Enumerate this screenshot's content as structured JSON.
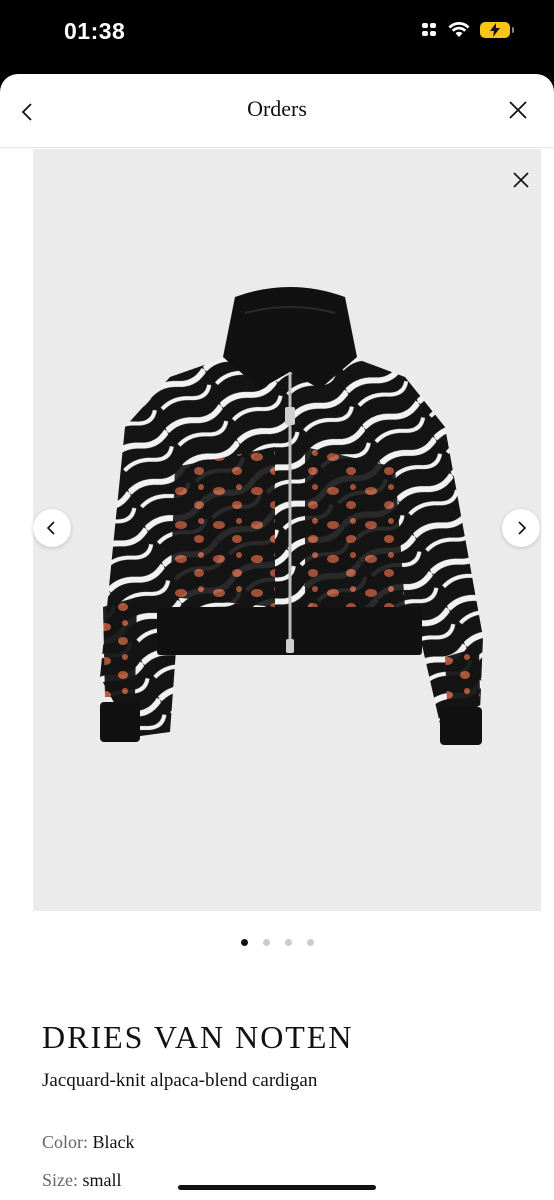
{
  "status_bar": {
    "time": "01:38"
  },
  "nav": {
    "title": "Orders"
  },
  "gallery": {
    "image_count": 4,
    "active_index": 0
  },
  "product": {
    "brand": "DRIES VAN NOTEN",
    "name": "Jacquard-knit alpaca-blend cardigan",
    "color_label": "Color:",
    "color_value": "Black",
    "size_label": "Size:",
    "size_value": "small"
  },
  "colors": {
    "battery": "#f5c518",
    "garment": "#141414",
    "leopard": "#b0573a"
  },
  "icons": [
    "back-icon",
    "close-icon",
    "chevron-left-icon",
    "chevron-right-icon",
    "signal-icon",
    "wifi-icon",
    "battery-icon"
  ]
}
